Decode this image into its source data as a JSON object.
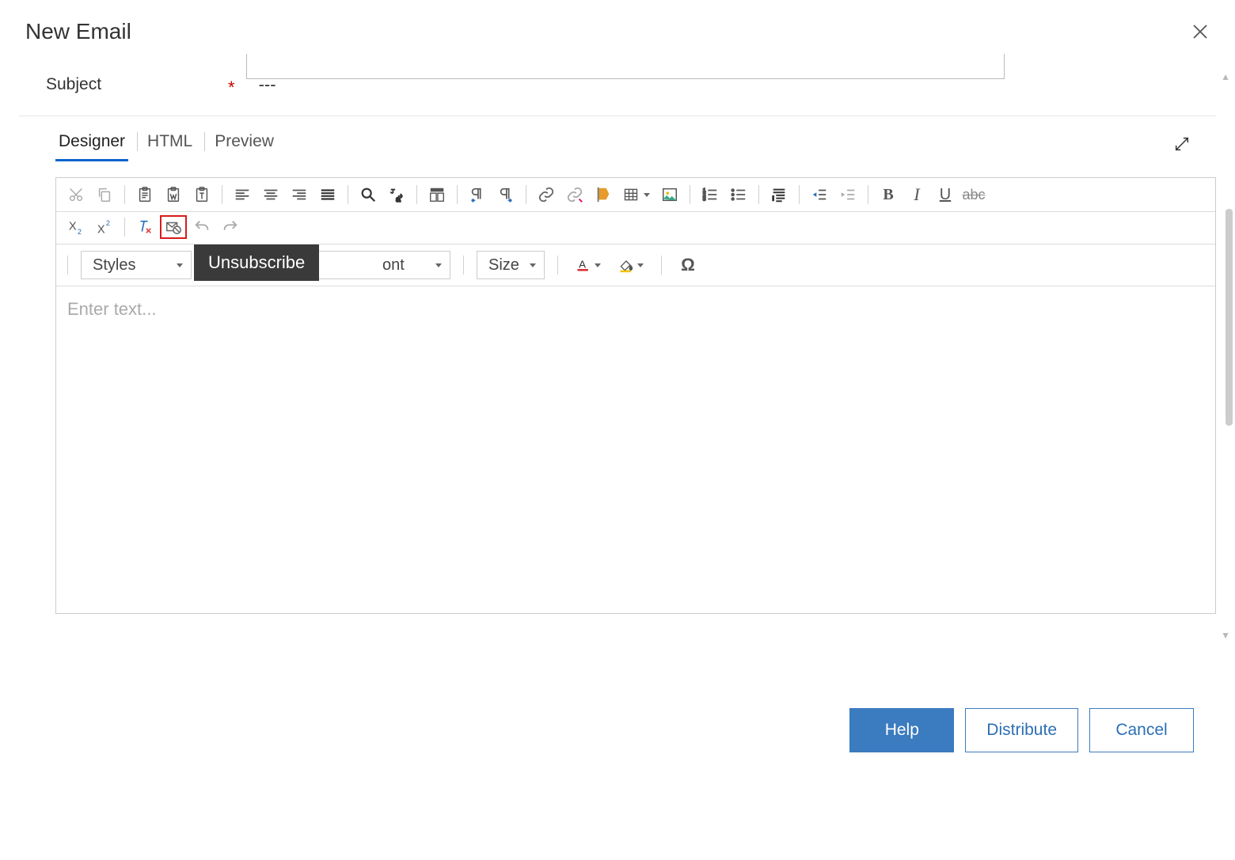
{
  "header": {
    "title": "New Email"
  },
  "subject": {
    "label": "Subject",
    "value": "---"
  },
  "tabs": {
    "designer": "Designer",
    "html": "HTML",
    "preview": "Preview"
  },
  "toolbar3": {
    "styles_label": "Styles",
    "font_fragment": "ont",
    "size_label": "Size"
  },
  "tooltip": {
    "unsubscribe": "Unsubscribe"
  },
  "editor": {
    "placeholder": "Enter text..."
  },
  "footer": {
    "help": "Help",
    "distribute": "Distribute",
    "cancel": "Cancel"
  }
}
